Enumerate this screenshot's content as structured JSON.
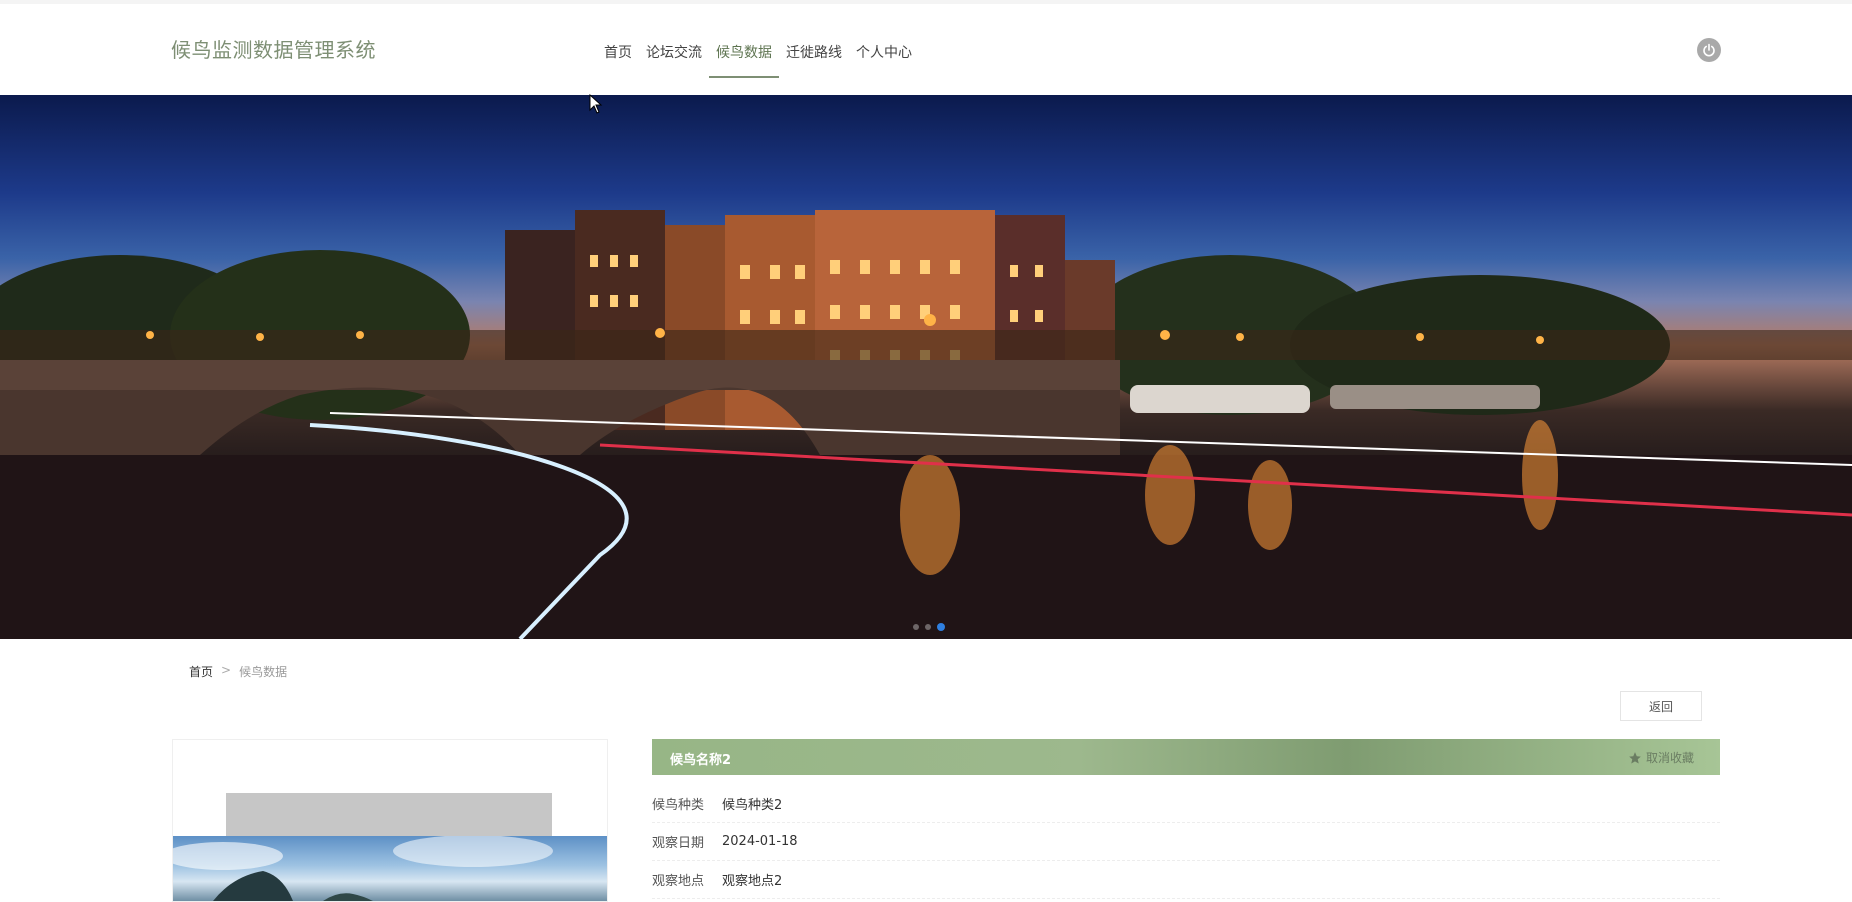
{
  "header": {
    "site_title": "候鸟监测数据管理系统",
    "nav": [
      {
        "label": "首页"
      },
      {
        "label": "论坛交流"
      },
      {
        "label": "候鸟数据",
        "active": true
      },
      {
        "label": "迁徙路线"
      },
      {
        "label": "个人中心"
      }
    ],
    "power_icon": "power-icon"
  },
  "banner": {
    "carousel_dots": 3,
    "active_dot": 3
  },
  "breadcrumb": {
    "home": "首页",
    "separator": ">",
    "current": "候鸟数据"
  },
  "back_button": "返回",
  "detail": {
    "title": "候鸟名称2",
    "favorite_label": "取消收藏",
    "rows": [
      {
        "label": "候鸟种类",
        "value": "候鸟种类2"
      },
      {
        "label": "观察日期",
        "value": "2024-01-18"
      },
      {
        "label": "观察地点",
        "value": "观察地点2"
      }
    ]
  },
  "colors": {
    "accent": "#7e8f74",
    "detail_bar": "#9db88d",
    "active_dot": "#2f7fe0"
  }
}
